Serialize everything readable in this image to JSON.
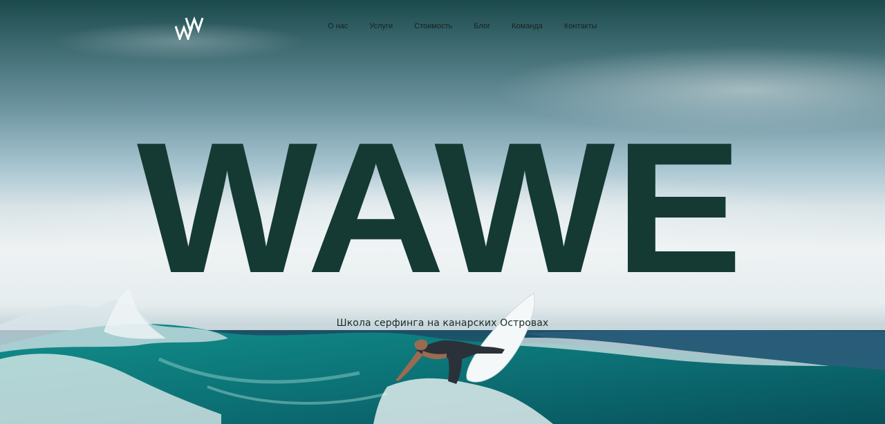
{
  "brand": {
    "logo_text": "WW",
    "title": "WAWE"
  },
  "nav": {
    "items": [
      {
        "label": "О нас"
      },
      {
        "label": "Услуги"
      },
      {
        "label": "Стоимость"
      },
      {
        "label": "Блог"
      },
      {
        "label": "Команда"
      },
      {
        "label": "Контакты"
      }
    ]
  },
  "hero": {
    "subtitle": "Школа серфинга на канарских Островах"
  },
  "colors": {
    "title": "#143a33",
    "nav_text": "#14231f"
  }
}
